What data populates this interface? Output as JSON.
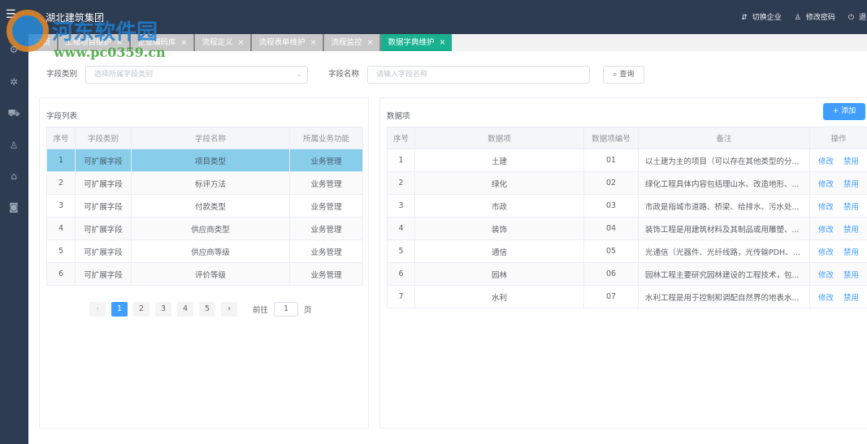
{
  "header": {
    "title": "湖北建筑集团",
    "actions": [
      {
        "icon": "switch-icon",
        "label": "切换企业"
      },
      {
        "icon": "user-icon",
        "label": "修改密码"
      },
      {
        "icon": "power-icon",
        "label": "退出"
      }
    ]
  },
  "sidebar": {
    "icons": [
      "org-icon",
      "gear-icon",
      "cart-icon",
      "user-settings-icon",
      "home-icon",
      "chart-icon"
    ]
  },
  "tabs": [
    {
      "label": "首页"
    },
    {
      "label": "工程项目维护"
    },
    {
      "label": "企业编码库"
    },
    {
      "label": "流程定义"
    },
    {
      "label": "流程表单维护"
    },
    {
      "label": "流程监控"
    },
    {
      "label": "数据字典维护",
      "active": true
    }
  ],
  "filter": {
    "type_label": "字段类别",
    "type_placeholder": "选择所属字段类别",
    "name_label": "字段名称",
    "name_placeholder": "请输入字段名称",
    "query_label": "查询"
  },
  "left": {
    "title": "字段列表",
    "columns": [
      "序号",
      "字段类别",
      "字段名称",
      "所属业务功能"
    ],
    "rows": [
      [
        "1",
        "可扩展字段",
        "项目类型",
        "业务管理"
      ],
      [
        "2",
        "可扩展字段",
        "标评方法",
        "业务管理"
      ],
      [
        "3",
        "可扩展字段",
        "付款类型",
        "业务管理"
      ],
      [
        "4",
        "可扩展字段",
        "供应商类型",
        "业务管理"
      ],
      [
        "5",
        "可扩展字段",
        "供应商等级",
        "业务管理"
      ],
      [
        "6",
        "可扩展字段",
        "评价等级",
        "业务管理"
      ]
    ],
    "selected_row": 1,
    "pager": {
      "pages": [
        "1",
        "2",
        "3",
        "4",
        "5"
      ],
      "current": "1",
      "goto_label": "前往",
      "goto_value": "1",
      "page_unit": "页"
    }
  },
  "right": {
    "title": "数据项",
    "add_label": "+ 添加",
    "columns": [
      "序号",
      "数据项",
      "数据项编号",
      "备注",
      "操作"
    ],
    "edit_label": "修改",
    "disable_label": "禁用",
    "rows": [
      [
        "1",
        "土建",
        "01",
        "以土建为主的项目（可以存在其他类型的分..."
      ],
      [
        "2",
        "绿化",
        "02",
        "绿化工程具体内容包括理山水、改造地形、..."
      ],
      [
        "3",
        "市政",
        "03",
        "市政是指城市道路、桥梁、给排水、污水处..."
      ],
      [
        "4",
        "装饰",
        "04",
        "装饰工程是用建筑材料及其制品或用雕塑、..."
      ],
      [
        "5",
        "通信",
        "05",
        "光通信（光器件、光纤线路，光传输PDH、..."
      ],
      [
        "6",
        "园林",
        "06",
        "园林工程主要研究园林建设的工程技术，包..."
      ],
      [
        "7",
        "水利",
        "07",
        "水利工程是用于控制和调配自然界的地表水..."
      ]
    ]
  },
  "watermark": {
    "text": "河东软件园",
    "url": "www.pc0359.cn"
  },
  "colors": {
    "header": "#2e3c52",
    "active_tab": "#19b18f",
    "primary": "#409eff",
    "selected_row": "#88cdea"
  }
}
